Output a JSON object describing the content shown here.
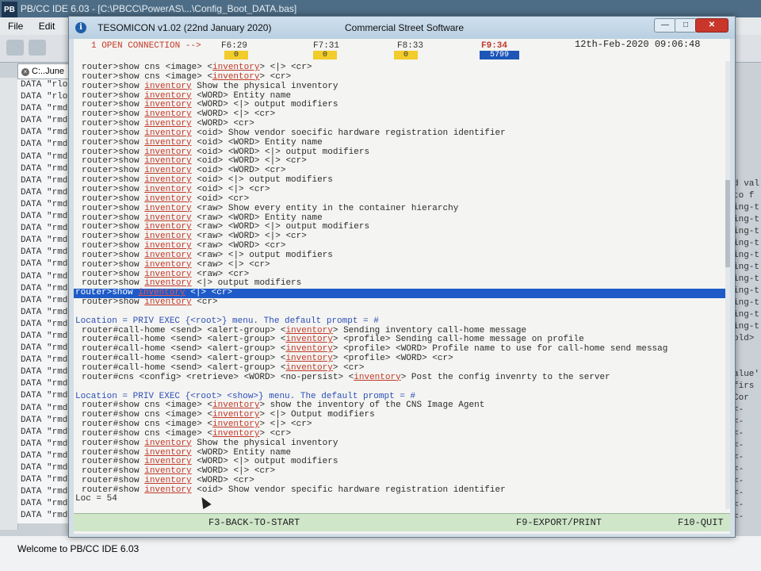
{
  "ide": {
    "title": "PB/CC IDE 6.03 - [C:\\PBCC\\PowerAS\\...\\Config_Boot_DATA.bas]",
    "pb_logo": "PB",
    "menu": [
      "File",
      "Edit"
    ],
    "tab_label": "C:..June",
    "data_lines": [
      "DATA \"rlo",
      "DATA \"rlo",
      "DATA \"rmd",
      "DATA \"rmd",
      "DATA \"rmd",
      "DATA \"rmd",
      "DATA \"rmd",
      "DATA \"rmd",
      "DATA \"rmd",
      "DATA \"rmd",
      "DATA \"rmd",
      "DATA \"rmd",
      "DATA \"rmd",
      "DATA \"rmd",
      "DATA \"rmd",
      "DATA \"rmd",
      "DATA \"rmd",
      "DATA \"rmd",
      "DATA \"rmd",
      "DATA \"rmd",
      "DATA \"rmd",
      "DATA \"rmd",
      "DATA \"rmd",
      "DATA \"rmd",
      "DATA \"rmd",
      "DATA \"rmd",
      "DATA \"rmd",
      "DATA \"rmd",
      "DATA \"rmd",
      "DATA \"rmd",
      "DATA \"rmd",
      "DATA \"rmd",
      "DATA \"rmd",
      "DATA \"rmd",
      "DATA \"rmd",
      "DATA \"rmd",
      "DATA \"rmd"
    ],
    "right_fragments": [
      "d val",
      "to f",
      "ing-t",
      "ing-t",
      "ing-t",
      "ing-t",
      "ing-t",
      "ing-t",
      "ing-t",
      "ing-t",
      "ing-t",
      "ing-t",
      "ing-t",
      "old>",
      "",
      "",
      "alue'",
      "firs",
      "Cor",
      "<-",
      "<-",
      "<-",
      "<-",
      "<-",
      "<-",
      "<-",
      "<-",
      "<-",
      "<-"
    ],
    "status_message": "Welcome to PB/CC IDE 6.03"
  },
  "window": {
    "title": "TESOMICON v1.02  (22nd January 2020)",
    "company": "Commercial Street Software",
    "info_icon": "i",
    "btn_min": "—",
    "btn_max": "□",
    "btn_close": "✕"
  },
  "header": {
    "connection": "1 OPEN CONNECTION -->",
    "f6": "F6:29",
    "f6_count": "0",
    "f7": "F7:31",
    "f7_count": "0",
    "f8": "F8:33",
    "f8_count": "0",
    "f9": "F9:34",
    "f9_count": "5799",
    "datetime": "12th-Feb-2020 09:06:48"
  },
  "lines": [
    {
      "type": "cmd",
      "pre": "router>show cns <image> <",
      "kw": "inventory",
      "post": "> <|> <cr>"
    },
    {
      "type": "cmd",
      "pre": "router>show cns <image> <",
      "kw": "inventory",
      "post": "> <cr>"
    },
    {
      "type": "cmd",
      "pre": "router>show ",
      "kw": "inventory",
      "post": " Show the physical inventory"
    },
    {
      "type": "cmd",
      "pre": "router>show ",
      "kw": "inventory",
      "post": " <WORD> Entity name"
    },
    {
      "type": "cmd",
      "pre": "router>show ",
      "kw": "inventory",
      "post": " <WORD> <|> output modifiers"
    },
    {
      "type": "cmd",
      "pre": "router>show ",
      "kw": "inventory",
      "post": " <WORD> <|> <cr>"
    },
    {
      "type": "cmd",
      "pre": "router>show ",
      "kw": "inventory",
      "post": " <WORD> <cr>"
    },
    {
      "type": "cmd",
      "pre": "router>show ",
      "kw": "inventory",
      "post": " <oid> Show vendor soecific hardware registration identifier"
    },
    {
      "type": "cmd",
      "pre": "router>show ",
      "kw": "inventory",
      "post": " <oid> <WORD> Entity name"
    },
    {
      "type": "cmd",
      "pre": "router>show ",
      "kw": "inventory",
      "post": " <oid> <WORD> <|> output modifiers"
    },
    {
      "type": "cmd",
      "pre": "router>show ",
      "kw": "inventory",
      "post": " <oid> <WORD> <|> <cr>"
    },
    {
      "type": "cmd",
      "pre": "router>show ",
      "kw": "inventory",
      "post": " <oid> <WORD> <cr>"
    },
    {
      "type": "cmd",
      "pre": "router>show ",
      "kw": "inventory",
      "post": " <oid> <|> output modifiers"
    },
    {
      "type": "cmd",
      "pre": "router>show ",
      "kw": "inventory",
      "post": " <oid> <|> <cr>"
    },
    {
      "type": "cmd",
      "pre": "router>show ",
      "kw": "inventory",
      "post": " <oid> <cr>"
    },
    {
      "type": "cmd",
      "pre": "router>show ",
      "kw": "inventory",
      "post": " <raw> Show every entity in the container hierarchy"
    },
    {
      "type": "cmd",
      "pre": "router>show ",
      "kw": "inventory",
      "post": " <raw> <WORD> Entity name"
    },
    {
      "type": "cmd",
      "pre": "router>show ",
      "kw": "inventory",
      "post": " <raw> <WORD> <|> output modifiers"
    },
    {
      "type": "cmd",
      "pre": "router>show ",
      "kw": "inventory",
      "post": " <raw> <WORD> <|> <cr>"
    },
    {
      "type": "cmd",
      "pre": "router>show ",
      "kw": "inventory",
      "post": " <raw> <WORD> <cr>"
    },
    {
      "type": "cmd",
      "pre": "router>show ",
      "kw": "inventory",
      "post": " <raw> <|> output modifiers"
    },
    {
      "type": "cmd",
      "pre": "router>show ",
      "kw": "inventory",
      "post": " <raw> <|> <cr>"
    },
    {
      "type": "cmd",
      "pre": "router>show ",
      "kw": "inventory",
      "post": " <raw> <cr>"
    },
    {
      "type": "cmd",
      "pre": "router>show ",
      "kw": "inventory",
      "post": " <|> output modifiers"
    },
    {
      "type": "sel",
      "pre": "router>show ",
      "kw": "inventory",
      "post": " <|> <cr>"
    },
    {
      "type": "cmd",
      "pre": "router>show ",
      "kw": "inventory",
      "post": " <cr>"
    },
    {
      "type": "blank"
    },
    {
      "type": "loc",
      "text": "Location = PRIV EXEC {<root>} menu. The default prompt = #"
    },
    {
      "type": "cmd",
      "pre": "router#call-home <send> <alert-group> <",
      "kw": "inventory",
      "post": "> Sending inventory call-home message"
    },
    {
      "type": "cmd",
      "pre": "router#call-home <send> <alert-group> <",
      "kw": "inventory",
      "post": "> <profile> Sending call-home message on profile"
    },
    {
      "type": "cmd",
      "pre": "router#call-home <send> <alert-group> <",
      "kw": "inventory",
      "post": "> <profile> <WORD> Profile name to use for call-home send messag"
    },
    {
      "type": "cmd",
      "pre": "router#call-home <send> <alert-group> <",
      "kw": "inventory",
      "post": "> <profile> <WORD> <cr>"
    },
    {
      "type": "cmd",
      "pre": "router#call-home <send> <alert-group> <",
      "kw": "inventory",
      "post": "> <cr>"
    },
    {
      "type": "cmd",
      "pre": "router#cns <config> <retrieve> <WORD> <no-persist> <",
      "kw": "inventory",
      "post": "> Post the config invenrty to the server"
    },
    {
      "type": "blank"
    },
    {
      "type": "loc",
      "text": "Location = PRIV EXEC {<root> <show>} menu. The default prompt = #"
    },
    {
      "type": "cmd",
      "pre": "router#show cns <image> <",
      "kw": "inventory",
      "post": "> show the inventory of the CNS Image Agent"
    },
    {
      "type": "cmd",
      "pre": "router#show cns <image> <",
      "kw": "inventory",
      "post": "> <|> Output modifiers"
    },
    {
      "type": "cmd",
      "pre": "router#show cns <image> <",
      "kw": "inventory",
      "post": "> <|> <cr>"
    },
    {
      "type": "cmd",
      "pre": "router#show cns <image> <",
      "kw": "inventory",
      "post": "> <cr>"
    },
    {
      "type": "cmd",
      "pre": "router#show ",
      "kw": "inventory",
      "post": " Show the physical inventory"
    },
    {
      "type": "cmd",
      "pre": "router#show ",
      "kw": "inventory",
      "post": " <WORD> Entity name"
    },
    {
      "type": "cmd",
      "pre": "router#show ",
      "kw": "inventory",
      "post": " <WORD> <|> output modifiers"
    },
    {
      "type": "cmd",
      "pre": "router#show ",
      "kw": "inventory",
      "post": " <WORD> <|> <cr>"
    },
    {
      "type": "cmd",
      "pre": "router#show ",
      "kw": "inventory",
      "post": " <WORD> <cr>"
    },
    {
      "type": "cmd",
      "pre": "router#show ",
      "kw": "inventory",
      "post": " <oid> Show vendor specific hardware registration identifier"
    }
  ],
  "loc": "Loc =   54",
  "footer": {
    "f3": "F3-BACK-TO-START",
    "f9": "F9-EXPORT/PRINT",
    "f10": "F10-QUIT"
  }
}
